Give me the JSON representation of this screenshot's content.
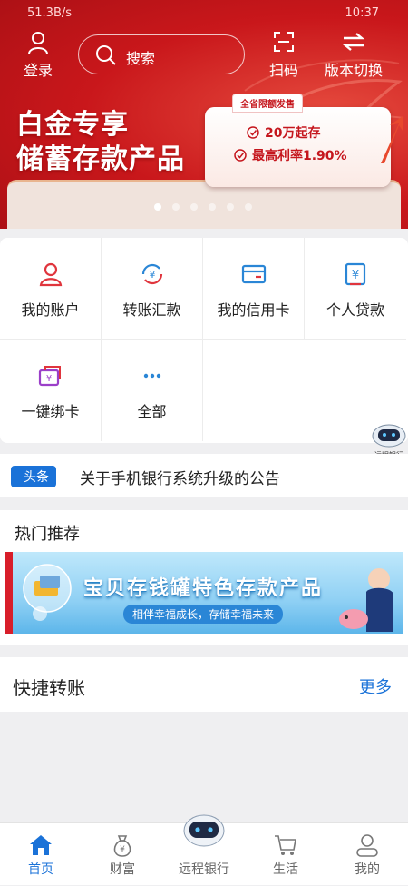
{
  "status_bar": {
    "left": "51.3B/s",
    "right": "10:37"
  },
  "toolbar": {
    "login_label": "登录",
    "search_placeholder": "搜索",
    "scan_label": "扫码",
    "switch_label": "版本切换"
  },
  "hero": {
    "title_line1": "白金专享",
    "title_line2": "储蓄存款产品",
    "tag": "全省限额发售",
    "point1": "20万起存",
    "point2": "最高利率1.90%",
    "slide_count": 6,
    "active_slide": 1
  },
  "grid": [
    {
      "label": "我的账户",
      "icon": "user-account-icon"
    },
    {
      "label": "转账汇款",
      "icon": "transfer-icon"
    },
    {
      "label": "我的信用卡",
      "icon": "credit-card-icon"
    },
    {
      "label": "个人贷款",
      "icon": "loan-icon"
    },
    {
      "label": "一键绑卡",
      "icon": "bind-card-icon"
    },
    {
      "label": "全部",
      "icon": "more-dots-icon"
    }
  ],
  "floating_robot": {
    "label": "远程银行"
  },
  "news": {
    "tag": "头条",
    "text": "关于手机银行系统升级的公告"
  },
  "hot": {
    "title": "热门推荐",
    "banner_title": "宝贝存钱罐特色存款产品",
    "banner_sub": "相伴幸福成长，存储幸福未来"
  },
  "quick": {
    "title": "快捷转账",
    "more": "更多"
  },
  "tabs": [
    {
      "label": "首页",
      "icon": "home-icon",
      "active": true
    },
    {
      "label": "财富",
      "icon": "money-bag-icon"
    },
    {
      "label": "远程银行",
      "icon": "robot-icon"
    },
    {
      "label": "生活",
      "icon": "cart-icon"
    },
    {
      "label": "我的",
      "icon": "person-icon"
    }
  ],
  "colors": {
    "brand_red": "#c5161d",
    "accent_blue": "#1a72d8"
  }
}
